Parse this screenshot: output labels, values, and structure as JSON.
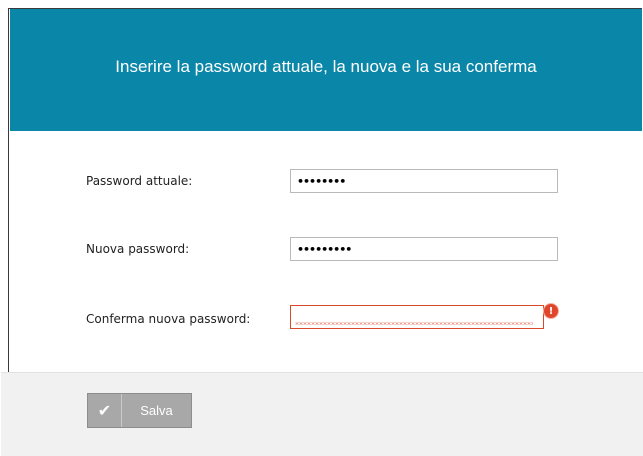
{
  "header": {
    "title": "Inserire la password attuale, la nuova e la sua conferma",
    "background": "#0a86a8"
  },
  "form": {
    "current_password": {
      "label": "Password attuale:",
      "value": "••••••••"
    },
    "new_password": {
      "label": "Nuova password:",
      "value": "•••••••••"
    },
    "confirm_password": {
      "label": "Conferma nuova password:",
      "value": "",
      "state": "error"
    }
  },
  "icons": {
    "error": "!"
  },
  "footer": {
    "save_label": "Salva",
    "save_icon": "✔"
  },
  "colors": {
    "error": "#d94a2b",
    "button": "#a8a8a8"
  }
}
